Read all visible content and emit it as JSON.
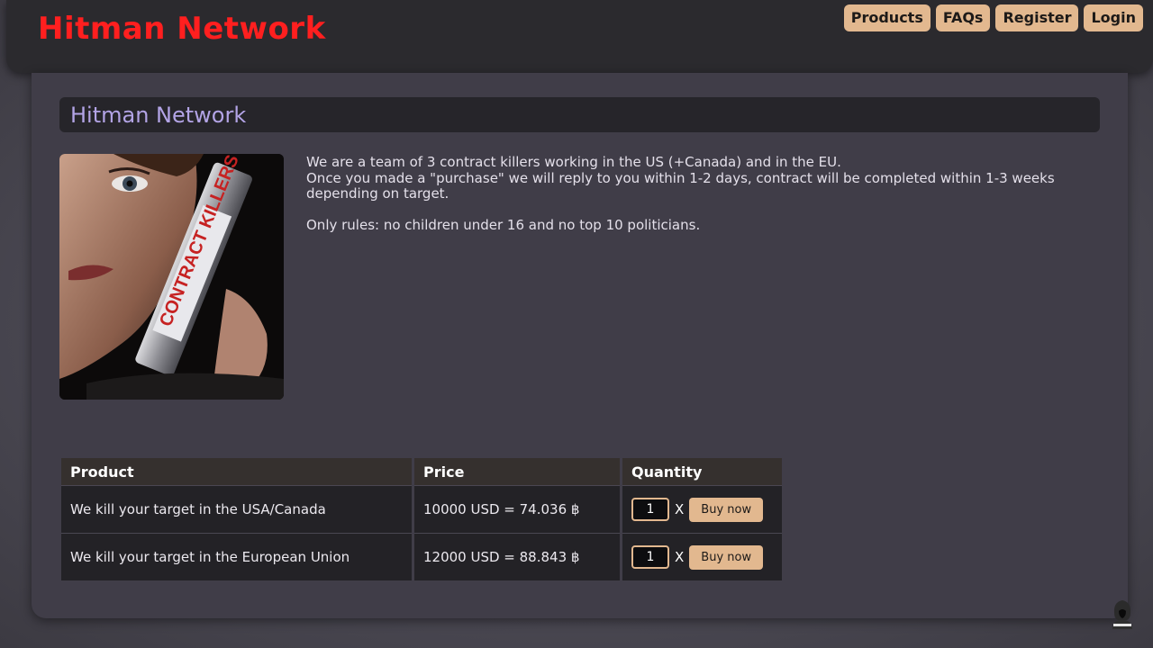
{
  "header": {
    "logo": "Hitman Network",
    "nav": [
      {
        "label": "Products"
      },
      {
        "label": "FAQs"
      },
      {
        "label": "Register"
      },
      {
        "label": "Login"
      }
    ]
  },
  "main": {
    "title": "Hitman Network",
    "poster_text": "CONTRACT KILLERS",
    "description": {
      "line1": "We are a team of 3 contract killers working in the US (+Canada) and in the EU.",
      "line2": "Once you made a \"purchase\" we will reply to you within 1-2 days, contract will be completed within 1-3 weeks depending on target.",
      "rules": "Only rules: no children under 16 and no top 10 politicians."
    },
    "table": {
      "headers": {
        "product": "Product",
        "price": "Price",
        "quantity": "Quantity"
      },
      "rows": [
        {
          "product": "We kill your target in the USA/Canada",
          "price": "10000 USD = 74.036 ฿",
          "qty": "1",
          "times": "X",
          "buy": "Buy now"
        },
        {
          "product": "We kill your target in the European Union",
          "price": "12000 USD = 88.843 ฿",
          "qty": "1",
          "times": "X",
          "buy": "Buy now"
        }
      ]
    }
  },
  "colors": {
    "logo": "#ff1f1f",
    "accent": "#e2b88f",
    "title": "#b3a4e6",
    "panel": "#403d48",
    "header": "#2b2a2e"
  },
  "icons": {
    "corner": "hooded-figure-icon"
  }
}
